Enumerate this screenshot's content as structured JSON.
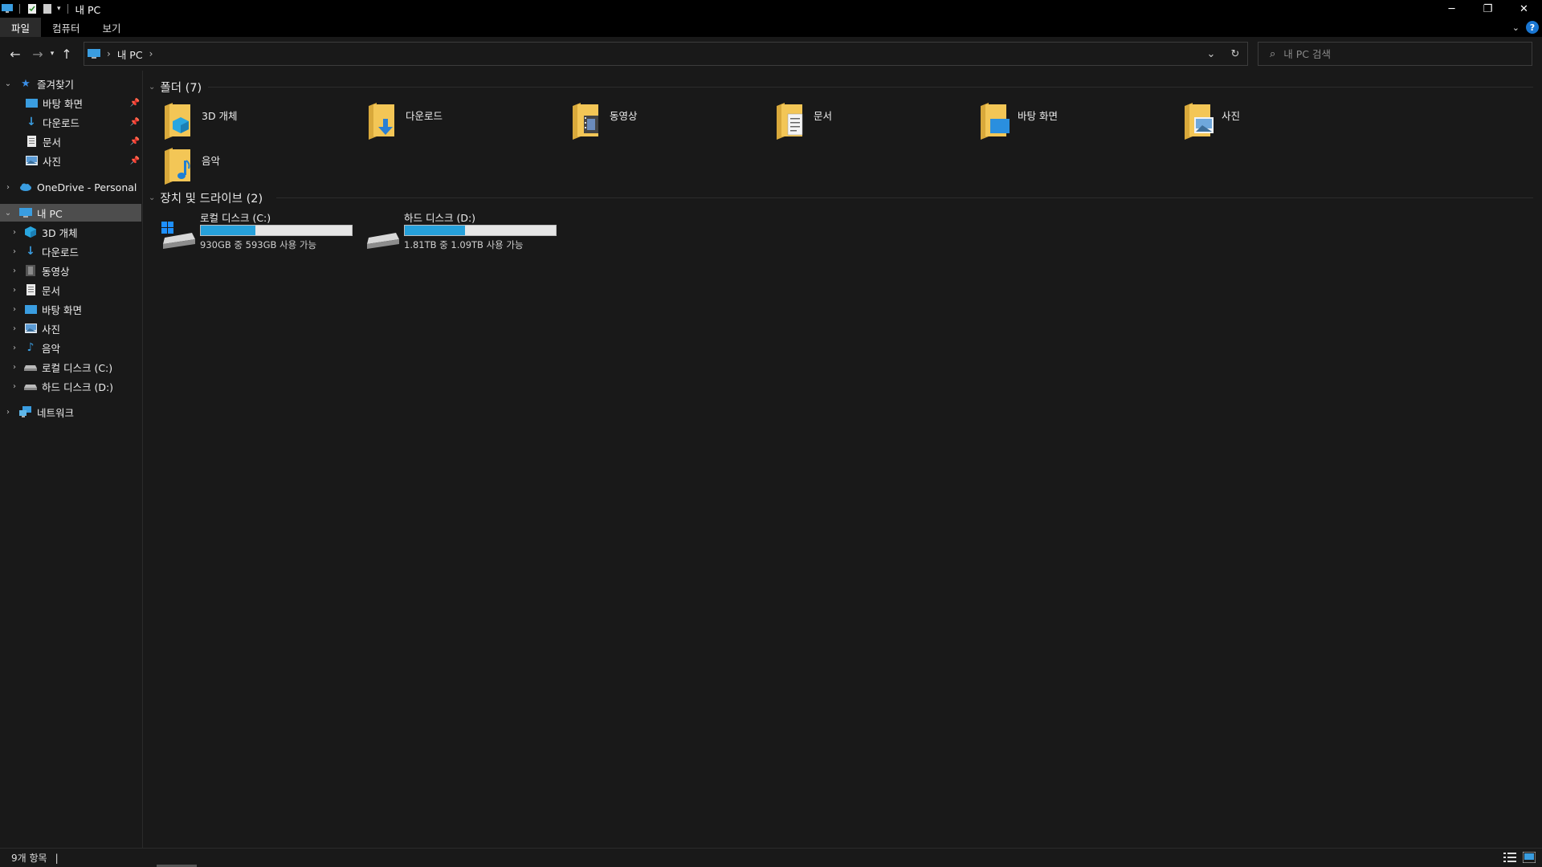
{
  "window": {
    "title": "내 PC"
  },
  "ribbon": {
    "tabs": [
      "파일",
      "컴퓨터",
      "보기"
    ],
    "active_tab": "파일"
  },
  "address": {
    "location": "내 PC"
  },
  "search": {
    "placeholder": "내 PC 검색"
  },
  "sidebar": {
    "quick_access": {
      "label": "즐겨찾기",
      "items": [
        "바탕 화면",
        "다운로드",
        "문서",
        "사진"
      ]
    },
    "onedrive": "OneDrive - Personal",
    "this_pc": {
      "label": "내 PC",
      "items": [
        "3D 개체",
        "다운로드",
        "동영상",
        "문서",
        "바탕 화면",
        "사진",
        "음악",
        "로컬 디스크 (C:)",
        "하드 디스크 (D:)"
      ]
    },
    "network": "네트워크"
  },
  "content": {
    "folders_header": "폴더 (7)",
    "folders": [
      "3D 개체",
      "다운로드",
      "동영상",
      "문서",
      "바탕 화면",
      "사진",
      "음악"
    ],
    "drives_header": "장치 및 드라이브 (2)",
    "drives": [
      {
        "name": "로컬 디스크 (C:)",
        "free_text": "930GB 중 593GB 사용 가능",
        "used_fraction": 0.36
      },
      {
        "name": "하드 디스크 (D:)",
        "free_text": "1.81TB 중 1.09TB 사용 가능",
        "used_fraction": 0.4
      }
    ]
  },
  "status": {
    "item_count": "9개 항목"
  },
  "colors": {
    "accent": "#26a0da",
    "folder": "#f3c656",
    "selected": "#4d4d4d"
  }
}
